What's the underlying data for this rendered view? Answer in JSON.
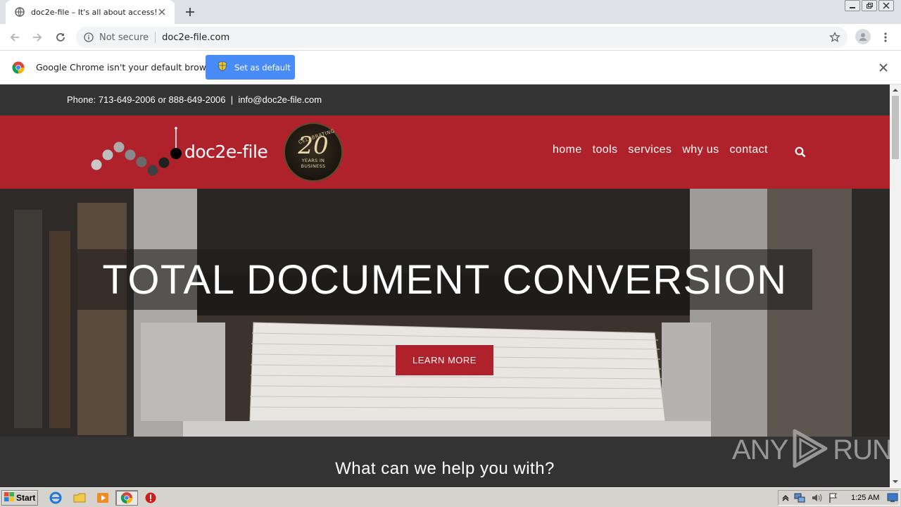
{
  "browser": {
    "tab_title": "doc2e-file – It's all about access!",
    "security_label": "Not secure",
    "url": "doc2e-file.com",
    "infobar_text": "Google Chrome isn't your default browser",
    "infobar_button": "Set as default"
  },
  "site": {
    "contact_line": "Phone: 713-649-2006 or 888-649-2006  |  info@doc2e-file.com",
    "logo_text": "doc2e-file",
    "badge": {
      "top": "CELEBRATING",
      "number": "20",
      "line1": "YEARS IN",
      "line2": "BUSINESS"
    },
    "nav": [
      "home",
      "tools",
      "services",
      "why us",
      "contact"
    ],
    "hero_title": "TOTAL DOCUMENT CONVERSION",
    "hero_button": "LEARN MORE",
    "help_title": "What can we help you with?",
    "brand_color": "#b0222b"
  },
  "watermark": {
    "text_left": "ANY",
    "text_right": "RUN"
  },
  "taskbar": {
    "start_label": "Start",
    "clock": "1:25 AM"
  }
}
